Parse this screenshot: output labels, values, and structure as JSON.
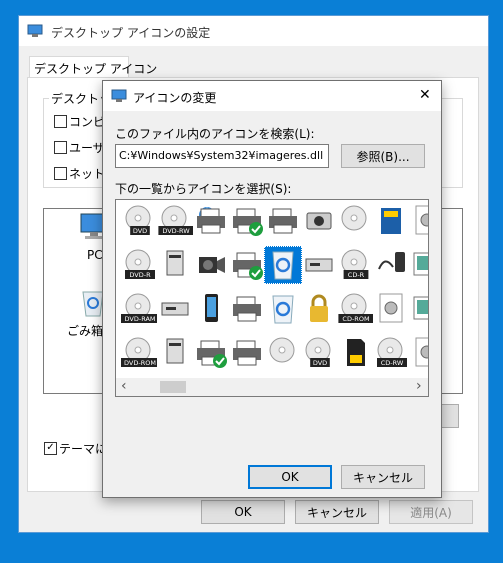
{
  "back_dialog": {
    "title": "デスクトップ アイコンの設定",
    "tab": "デスクトップ アイコン",
    "group_label": "デスクトップ",
    "checkbox_labels": [
      "コンピュ",
      "ユーザー",
      "ネットワ"
    ],
    "icons": [
      {
        "label": "PC",
        "icon": "computer-icon"
      },
      {
        "label": "ごみ箱",
        "icon": "recycle-bin-icon"
      }
    ],
    "theme_checkbox": "テーマによ",
    "buttons": {
      "ok": "OK",
      "cancel": "キャンセル",
      "apply": "適用(A)"
    }
  },
  "icon_dialog": {
    "title": "アイコンの変更",
    "close_glyph": "✕",
    "file_label": "このファイル内のアイコンを検索(L):",
    "file_value": "C:¥Windows¥System32¥imageres.dll",
    "browse_button": "参照(B)...",
    "list_label": "下の一覧からアイコンを選択(S):",
    "selected_icon": "recycle-bin-empty-icon",
    "scroll_left_glyph": "‹",
    "scroll_right_glyph": "›",
    "grid_badges": {
      "dvd": "DVD",
      "dvd_rw": "DVD-RW",
      "dvd_r": "DVD-R",
      "cd_r": "CD-R",
      "dvd_ram": "DVD-RAM",
      "cd_rom": "CD-ROM",
      "dvd_rom": "DVD-ROM",
      "cd_rw": "CD-RW"
    },
    "buttons": {
      "ok": "OK",
      "cancel": "キャンセル"
    }
  },
  "colors": {
    "desktop": "#0a7fd6",
    "accent": "#0078d7",
    "dialog_bg": "#f0f0f0"
  }
}
